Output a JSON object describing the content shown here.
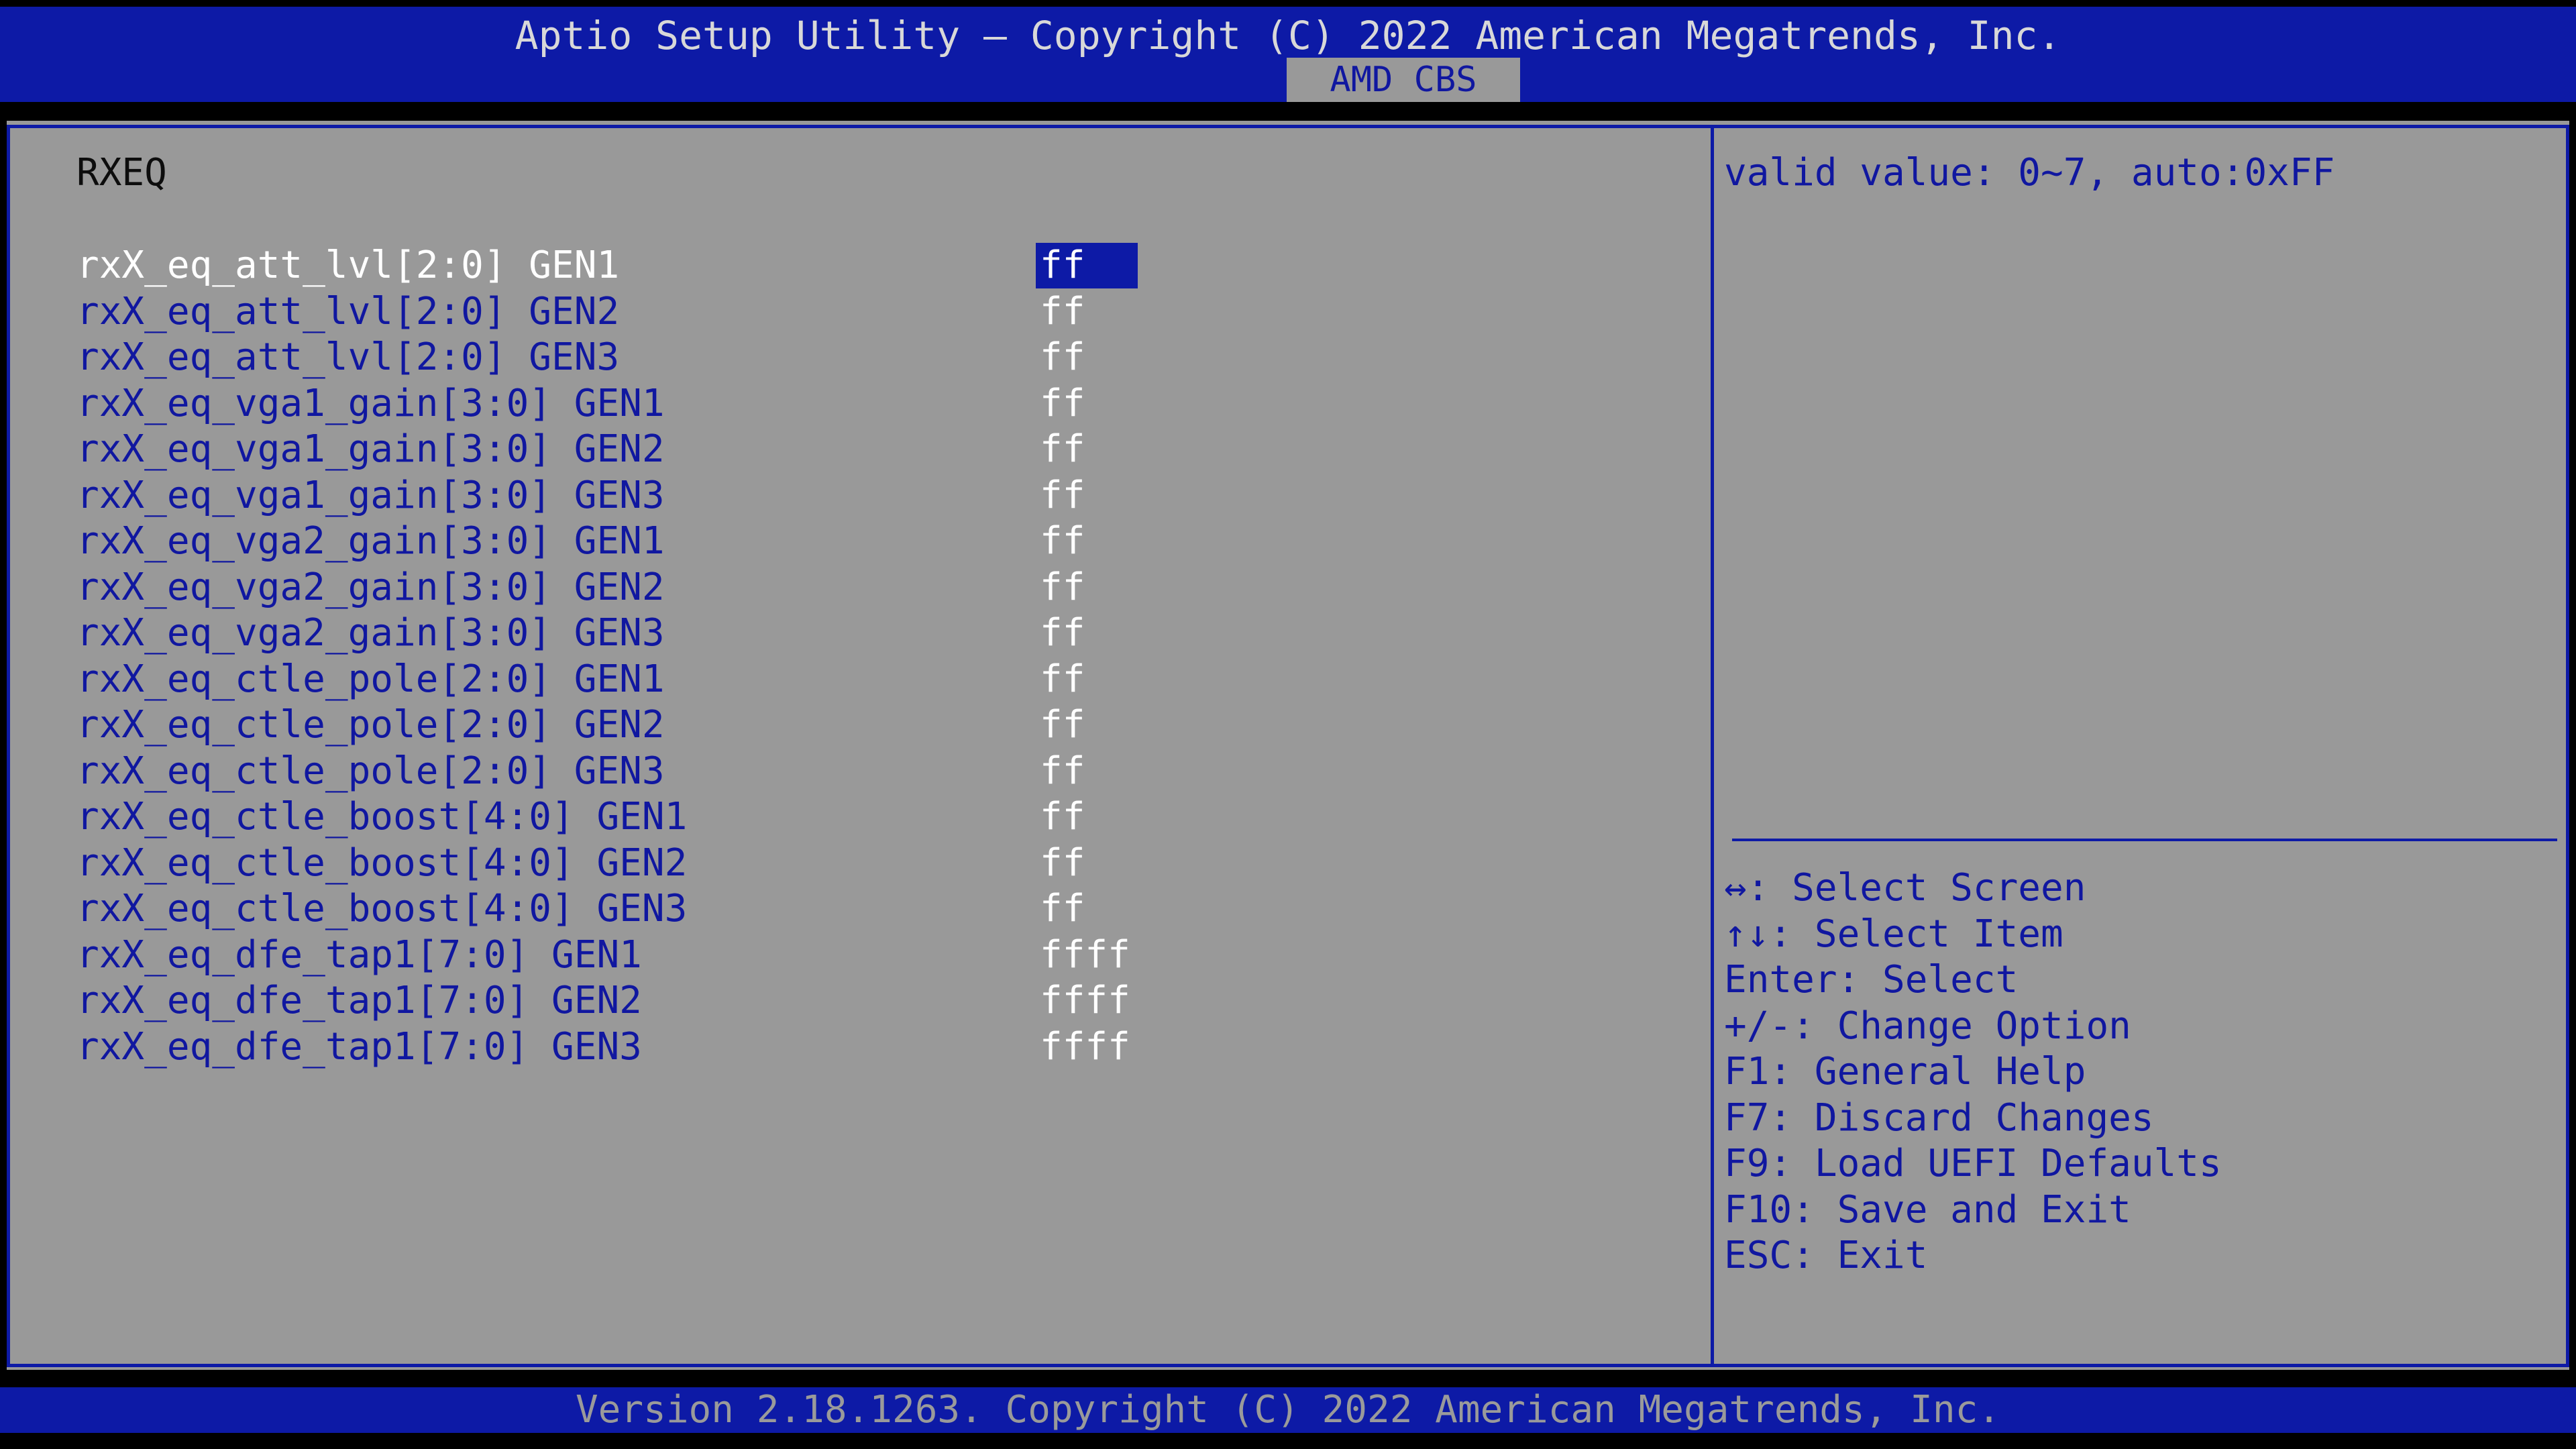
{
  "header": {
    "title": "Aptio Setup Utility – Copyright (C) 2022 American Megatrends, Inc.",
    "active_tab": "AMD CBS"
  },
  "main": {
    "section_title": "RXEQ",
    "items": [
      {
        "label": "rxX_eq_att_lvl[2:0] GEN1",
        "value": "ff",
        "selected": true
      },
      {
        "label": "rxX_eq_att_lvl[2:0] GEN2",
        "value": "ff"
      },
      {
        "label": "rxX_eq_att_lvl[2:0] GEN3",
        "value": "ff"
      },
      {
        "label": "rxX_eq_vga1_gain[3:0] GEN1",
        "value": "ff"
      },
      {
        "label": "rxX_eq_vga1_gain[3:0] GEN2",
        "value": "ff"
      },
      {
        "label": "rxX_eq_vga1_gain[3:0] GEN3",
        "value": "ff"
      },
      {
        "label": "rxX_eq_vga2_gain[3:0] GEN1",
        "value": "ff"
      },
      {
        "label": "rxX_eq_vga2_gain[3:0] GEN2",
        "value": "ff"
      },
      {
        "label": "rxX_eq_vga2_gain[3:0] GEN3",
        "value": "ff"
      },
      {
        "label": "rxX_eq_ctle_pole[2:0] GEN1",
        "value": "ff"
      },
      {
        "label": "rxX_eq_ctle_pole[2:0] GEN2",
        "value": "ff"
      },
      {
        "label": "rxX_eq_ctle_pole[2:0] GEN3",
        "value": "ff"
      },
      {
        "label": "rxX_eq_ctle_boost[4:0] GEN1",
        "value": "ff"
      },
      {
        "label": "rxX_eq_ctle_boost[4:0] GEN2",
        "value": "ff"
      },
      {
        "label": "rxX_eq_ctle_boost[4:0] GEN3",
        "value": "ff"
      },
      {
        "label": "rxX_eq_dfe_tap1[7:0] GEN1",
        "value": "ffff"
      },
      {
        "label": "rxX_eq_dfe_tap1[7:0] GEN2",
        "value": "ffff"
      },
      {
        "label": "rxX_eq_dfe_tap1[7:0] GEN3",
        "value": "ffff"
      }
    ]
  },
  "help": {
    "description": "valid value: 0~7, auto:0xFF",
    "keys": [
      "↔: Select Screen",
      "↑↓: Select Item",
      "Enter: Select",
      "+/-: Change Option",
      "F1: General Help",
      "F7: Discard Changes",
      "F9: Load UEFI Defaults",
      "F10: Save and Exit",
      "ESC: Exit"
    ]
  },
  "footer": {
    "text": "Version 2.18.1263. Copyright (C) 2022 American Megatrends, Inc."
  },
  "colors": {
    "bar_blue": "#0d1aa6",
    "panel_gray": "#999999",
    "text_blue": "#1017a0",
    "text_white": "#ffffff"
  }
}
